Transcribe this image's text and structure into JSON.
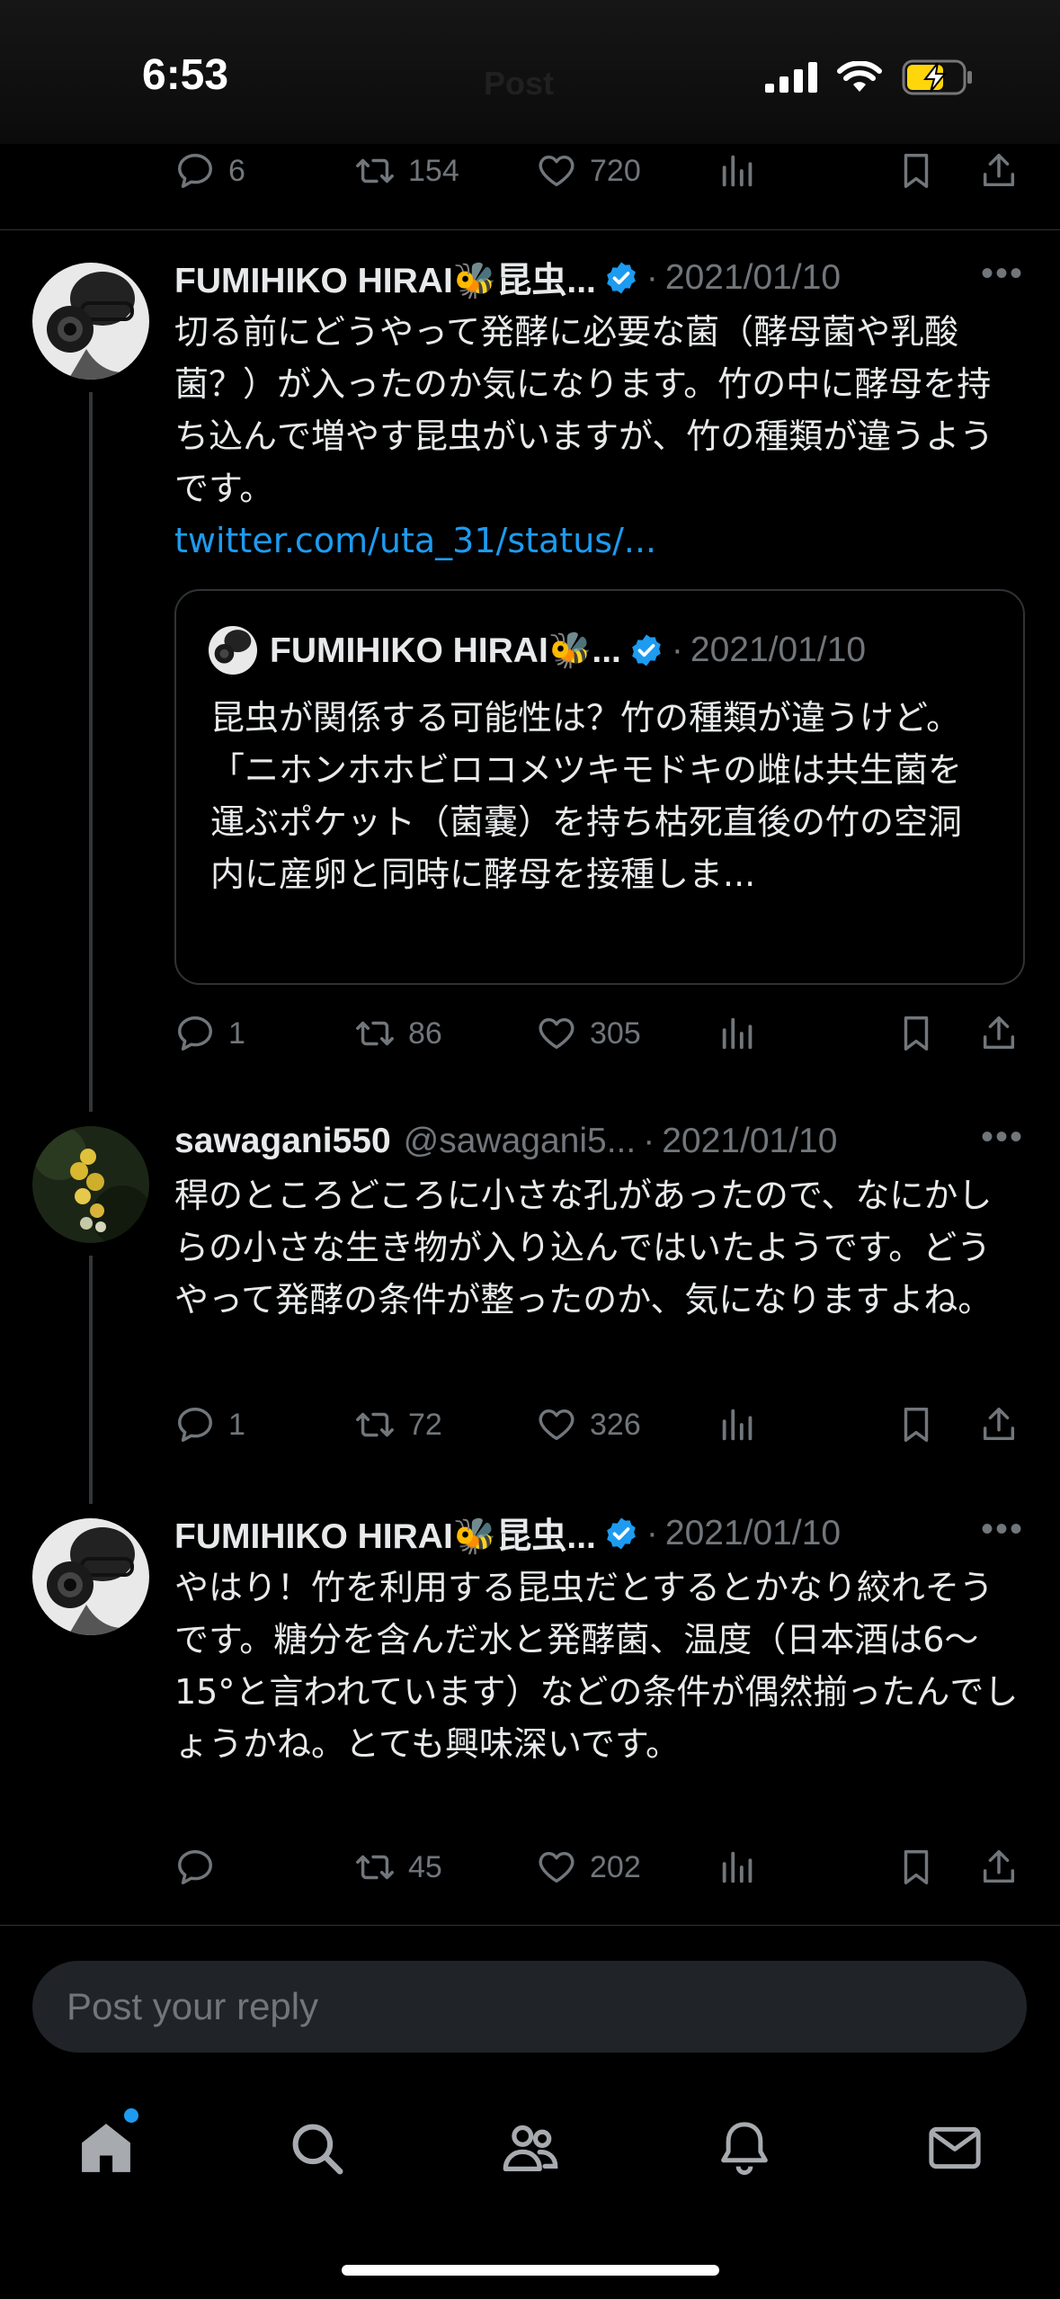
{
  "status": {
    "time": "6:53"
  },
  "page": {
    "title": "Post"
  },
  "top_actions": {
    "replies": "6",
    "reposts": "154",
    "likes": "720"
  },
  "tweets": [
    {
      "name": "FUMIHIKO HIRAI🐝昆虫...",
      "handle": "",
      "date": "2021/01/10",
      "text": "切る前にどうやって発酵に必要な菌（酵母菌や乳酸菌？）が入ったのか気になります。竹の中に酵母を持ち込んで増やす昆虫がいますが、竹の種類が違うようです。",
      "link": "twitter.com/uta_31/status/...",
      "quote": {
        "name": "FUMIHIKO HIRAI🐝...",
        "date": "2021/01/10",
        "text": "昆虫が関係する可能性は？竹の種類が違うけど。\n「ニホンホホビロコメツキモドキの雌は共生菌を運ぶポケット（菌嚢）を持ち枯死直後の竹の空洞内に産卵と同時に酵母を接種しま..."
      },
      "replies": "1",
      "reposts": "86",
      "likes": "305"
    },
    {
      "name": "sawagani550",
      "handle": "@sawagani5...",
      "date": "2021/01/10",
      "text": "稈のところどころに小さな孔があったので、なにかしらの小さな生き物が入り込んではいたようです。どうやって発酵の条件が整ったのか、気になりますよね。",
      "replies": "1",
      "reposts": "72",
      "likes": "326"
    },
    {
      "name": "FUMIHIKO HIRAI🐝昆虫...",
      "handle": "",
      "date": "2021/01/10",
      "text": "やはり！竹を利用する昆虫だとするとかなり絞れそうです。糖分を含んだ水と発酵菌、温度（日本酒は6〜15°と言われています）などの条件が偶然揃ったんでしょうかね。とても興味深いです。",
      "replies": "",
      "reposts": "45",
      "likes": "202"
    }
  ],
  "reply": {
    "placeholder": "Post your reply"
  },
  "nav": {
    "items": [
      "home-icon",
      "search-icon",
      "communities-icon",
      "notifications-icon",
      "messages-icon"
    ]
  },
  "colors": {
    "accent": "#1d9bf0",
    "muted": "#71767b",
    "bg": "#000000"
  }
}
